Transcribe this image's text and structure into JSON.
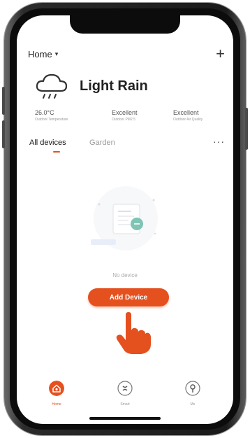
{
  "header": {
    "home_label": "Home",
    "chevron_icon": "chevron-down-icon",
    "add_icon": "plus-icon"
  },
  "weather": {
    "icon": "cloud-rain-icon",
    "condition": "Light Rain",
    "stats": [
      {
        "value": "26.0°C",
        "label": "Outdoor Temperature"
      },
      {
        "value": "Excellent",
        "label": "Outdoor PM2.5"
      },
      {
        "value": "Excellent",
        "label": "Outdoor Air Quality"
      }
    ]
  },
  "tabs": [
    {
      "label": "All devices",
      "active": true
    },
    {
      "label": "Garden",
      "active": false
    }
  ],
  "more_icon": "more-icon",
  "empty_state": {
    "text": "No device"
  },
  "add_button": {
    "label": "Add Device"
  },
  "bottom_nav": [
    {
      "label": "Home",
      "icon": "home-icon",
      "active": true
    },
    {
      "label": "Smart",
      "icon": "smart-icon",
      "active": false
    },
    {
      "label": "Me",
      "icon": "me-icon",
      "active": false
    }
  ],
  "colors": {
    "accent": "#e5501f",
    "text_primary": "#222222",
    "text_muted": "#999999"
  }
}
